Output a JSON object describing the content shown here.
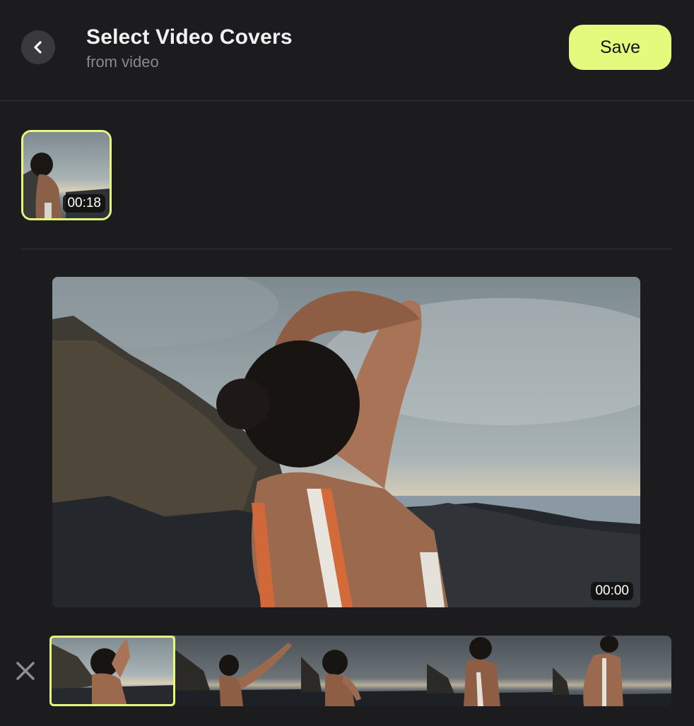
{
  "header": {
    "title": "Select Video Covers",
    "subtitle": "from video",
    "save_label": "Save",
    "back_icon": "chevron-left-icon"
  },
  "covers": [
    {
      "timestamp": "00:18",
      "selected": true
    }
  ],
  "preview": {
    "timestamp": "00:00"
  },
  "timeline": {
    "close_icon": "close-icon",
    "frame_count": 5,
    "selected_index": 0
  },
  "colors": {
    "background": "#1c1c1e",
    "accent": "#e3fa7c",
    "back_button": "#3a3a3c",
    "subtitle": "#8a8a8e"
  }
}
